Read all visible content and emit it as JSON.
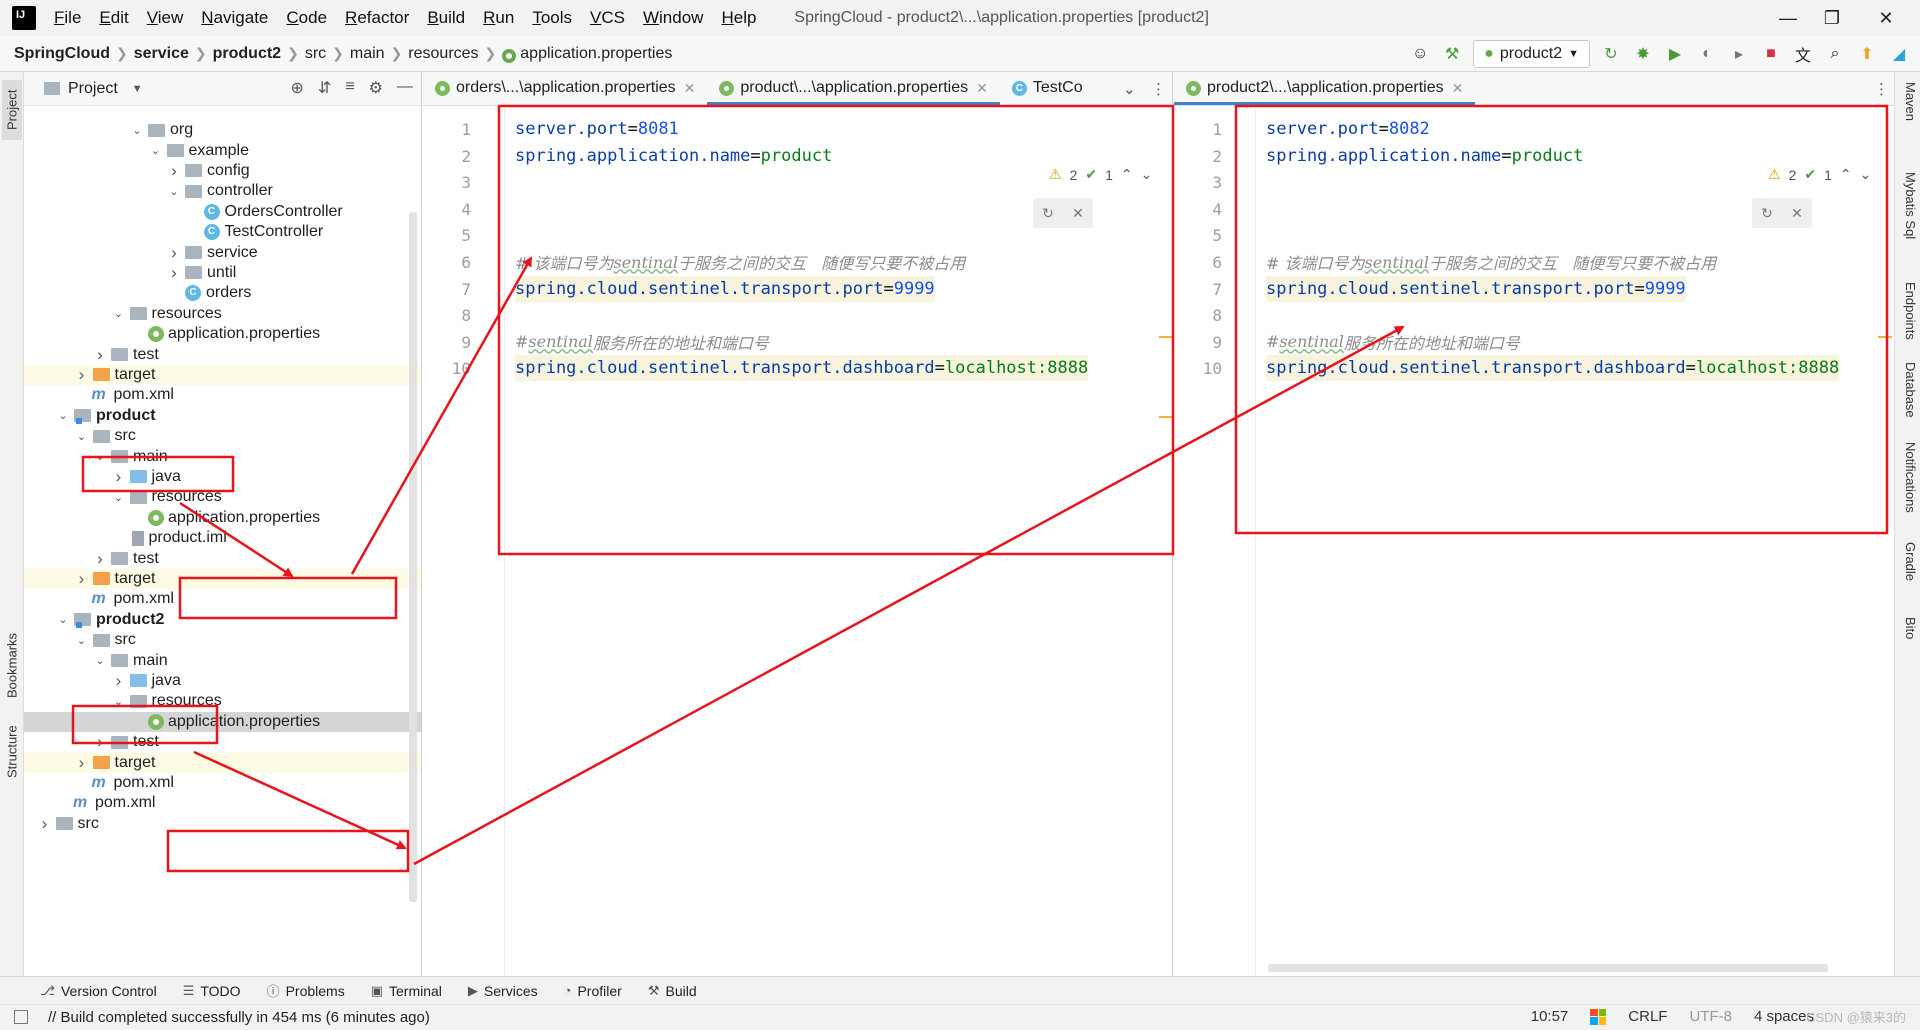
{
  "menubar": {
    "items": [
      "File",
      "Edit",
      "View",
      "Navigate",
      "Code",
      "Refactor",
      "Build",
      "Run",
      "Tools",
      "VCS",
      "Window",
      "Help"
    ],
    "window_title": "SpringCloud - product2\\...\\application.properties [product2]"
  },
  "navbar": {
    "crumbs": [
      "SpringCloud",
      "service",
      "product2",
      "src",
      "main",
      "resources",
      "application.properties"
    ],
    "run_config": "product2"
  },
  "project_panel": {
    "title": "Project",
    "tree": [
      {
        "label": "org",
        "kind": "folder",
        "depth": 6,
        "arrow": "v"
      },
      {
        "label": "example",
        "kind": "folder",
        "depth": 7,
        "arrow": "v"
      },
      {
        "label": "config",
        "kind": "folder",
        "depth": 8,
        "arrow": ">"
      },
      {
        "label": "controller",
        "kind": "folder",
        "depth": 8,
        "arrow": "v"
      },
      {
        "label": "OrdersController",
        "kind": "class",
        "depth": 9,
        "arrow": ""
      },
      {
        "label": "TestController",
        "kind": "class",
        "depth": 9,
        "arrow": ""
      },
      {
        "label": "service",
        "kind": "folder",
        "depth": 8,
        "arrow": ">"
      },
      {
        "label": "until",
        "kind": "folder",
        "depth": 8,
        "arrow": ">"
      },
      {
        "label": "orders",
        "kind": "class",
        "depth": 8,
        "arrow": ""
      },
      {
        "label": "resources",
        "kind": "res",
        "depth": 5,
        "arrow": "v"
      },
      {
        "label": "application.properties",
        "kind": "props",
        "depth": 6,
        "arrow": ""
      },
      {
        "label": "test",
        "kind": "folder",
        "depth": 4,
        "arrow": ">"
      },
      {
        "label": "target",
        "kind": "orange",
        "depth": 3,
        "arrow": ">",
        "yellow": true
      },
      {
        "label": "pom.xml",
        "kind": "maven",
        "depth": 3,
        "arrow": ""
      },
      {
        "label": "product",
        "kind": "module",
        "depth": 2,
        "arrow": "v",
        "bold": true
      },
      {
        "label": "src",
        "kind": "folder",
        "depth": 3,
        "arrow": "v"
      },
      {
        "label": "main",
        "kind": "folder",
        "depth": 4,
        "arrow": "v"
      },
      {
        "label": "java",
        "kind": "blue",
        "depth": 5,
        "arrow": ">"
      },
      {
        "label": "resources",
        "kind": "res",
        "depth": 5,
        "arrow": "v"
      },
      {
        "label": "application.properties",
        "kind": "props",
        "depth": 6,
        "arrow": ""
      },
      {
        "label": "product.iml",
        "kind": "iml",
        "depth": 5,
        "arrow": ""
      },
      {
        "label": "test",
        "kind": "folder",
        "depth": 4,
        "arrow": ">"
      },
      {
        "label": "target",
        "kind": "orange",
        "depth": 3,
        "arrow": ">",
        "yellow": true
      },
      {
        "label": "pom.xml",
        "kind": "maven",
        "depth": 3,
        "arrow": ""
      },
      {
        "label": "product2",
        "kind": "module",
        "depth": 2,
        "arrow": "v",
        "bold": true
      },
      {
        "label": "src",
        "kind": "folder",
        "depth": 3,
        "arrow": "v"
      },
      {
        "label": "main",
        "kind": "folder",
        "depth": 4,
        "arrow": "v"
      },
      {
        "label": "java",
        "kind": "blue",
        "depth": 5,
        "arrow": ">"
      },
      {
        "label": "resources",
        "kind": "res",
        "depth": 5,
        "arrow": "v"
      },
      {
        "label": "application.properties",
        "kind": "props",
        "depth": 6,
        "arrow": "",
        "selected": true
      },
      {
        "label": "test",
        "kind": "folder",
        "depth": 4,
        "arrow": ">"
      },
      {
        "label": "target",
        "kind": "orange",
        "depth": 3,
        "arrow": ">",
        "yellow": true
      },
      {
        "label": "pom.xml",
        "kind": "maven",
        "depth": 3,
        "arrow": ""
      },
      {
        "label": "pom.xml",
        "kind": "maven",
        "depth": 2,
        "arrow": ""
      },
      {
        "label": "src",
        "kind": "folder",
        "depth": 1,
        "arrow": ">"
      }
    ]
  },
  "left_editor": {
    "tabs": [
      {
        "label": "orders\\...\\application.properties",
        "icon": "props",
        "active": false
      },
      {
        "label": "product\\...\\application.properties",
        "icon": "props",
        "active": true
      },
      {
        "label": "TestCo",
        "icon": "class",
        "active": false
      }
    ],
    "inspections": {
      "warnings": "2",
      "ok": "1"
    },
    "lines": [
      {
        "n": "1",
        "key": "server.port",
        "val": "8081",
        "type": "num"
      },
      {
        "n": "2",
        "key": "spring.application.name",
        "val": "product",
        "type": "str"
      },
      {
        "n": "3"
      },
      {
        "n": "4"
      },
      {
        "n": "5"
      },
      {
        "n": "6",
        "comment_pre": "# 该端口号为",
        "comment_word": "sentinal",
        "comment_post": "于服务之间的交互   随便写只要不被占用"
      },
      {
        "n": "7",
        "key": "spring.cloud.sentinel.transport.port",
        "val": "9999",
        "type": "num",
        "hl": true
      },
      {
        "n": "8"
      },
      {
        "n": "9",
        "comment_pre": "#",
        "comment_word": "sentinal",
        "comment_post": "服务所在的地址和端口号"
      },
      {
        "n": "10",
        "key": "spring.cloud.sentinel.transport.dashboard",
        "val": "localhost:8888",
        "type": "str",
        "hl": true
      }
    ]
  },
  "right_editor": {
    "tabs": [
      {
        "label": "product2\\...\\application.properties",
        "icon": "props",
        "active": true
      }
    ],
    "inspections": {
      "warnings": "2",
      "ok": "1"
    },
    "lines": [
      {
        "n": "1",
        "key": "server.port",
        "val": "8082",
        "type": "num"
      },
      {
        "n": "2",
        "key": "spring.application.name",
        "val": "product",
        "type": "str"
      },
      {
        "n": "3"
      },
      {
        "n": "4"
      },
      {
        "n": "5"
      },
      {
        "n": "6",
        "comment_pre": "# 该端口号为",
        "comment_word": "sentinal",
        "comment_post": "于服务之间的交互   随便写只要不被占用"
      },
      {
        "n": "7",
        "key": "spring.cloud.sentinel.transport.port",
        "val": "9999",
        "type": "num",
        "hl": true
      },
      {
        "n": "8"
      },
      {
        "n": "9",
        "comment_pre": "#",
        "comment_word": "sentinal",
        "comment_post": "服务所在的地址和端口号"
      },
      {
        "n": "10",
        "key": "spring.cloud.sentinel.transport.dashboard",
        "val": "localhost:8888",
        "type": "str",
        "hl": true
      }
    ]
  },
  "left_strip": {
    "project": "Project",
    "bookmarks": "Bookmarks",
    "structure": "Structure"
  },
  "right_strip": [
    "Maven",
    "Mybatis Sql",
    "Endpoints",
    "Database",
    "Notifications",
    "Gradle",
    "Bito"
  ],
  "bottom_tools": [
    "Version Control",
    "TODO",
    "Problems",
    "Terminal",
    "Services",
    "Profiler",
    "Build"
  ],
  "status": {
    "message": "// Build completed successfully in 454 ms (6 minutes ago)",
    "position": "10:57",
    "line_sep": "CRLF",
    "encoding": "UTF-8",
    "indent": "4 spaces",
    "watermark": "CSDN @猿来3的"
  },
  "colors": {
    "annotation": "#e8141c",
    "accent": "#4083c9"
  }
}
